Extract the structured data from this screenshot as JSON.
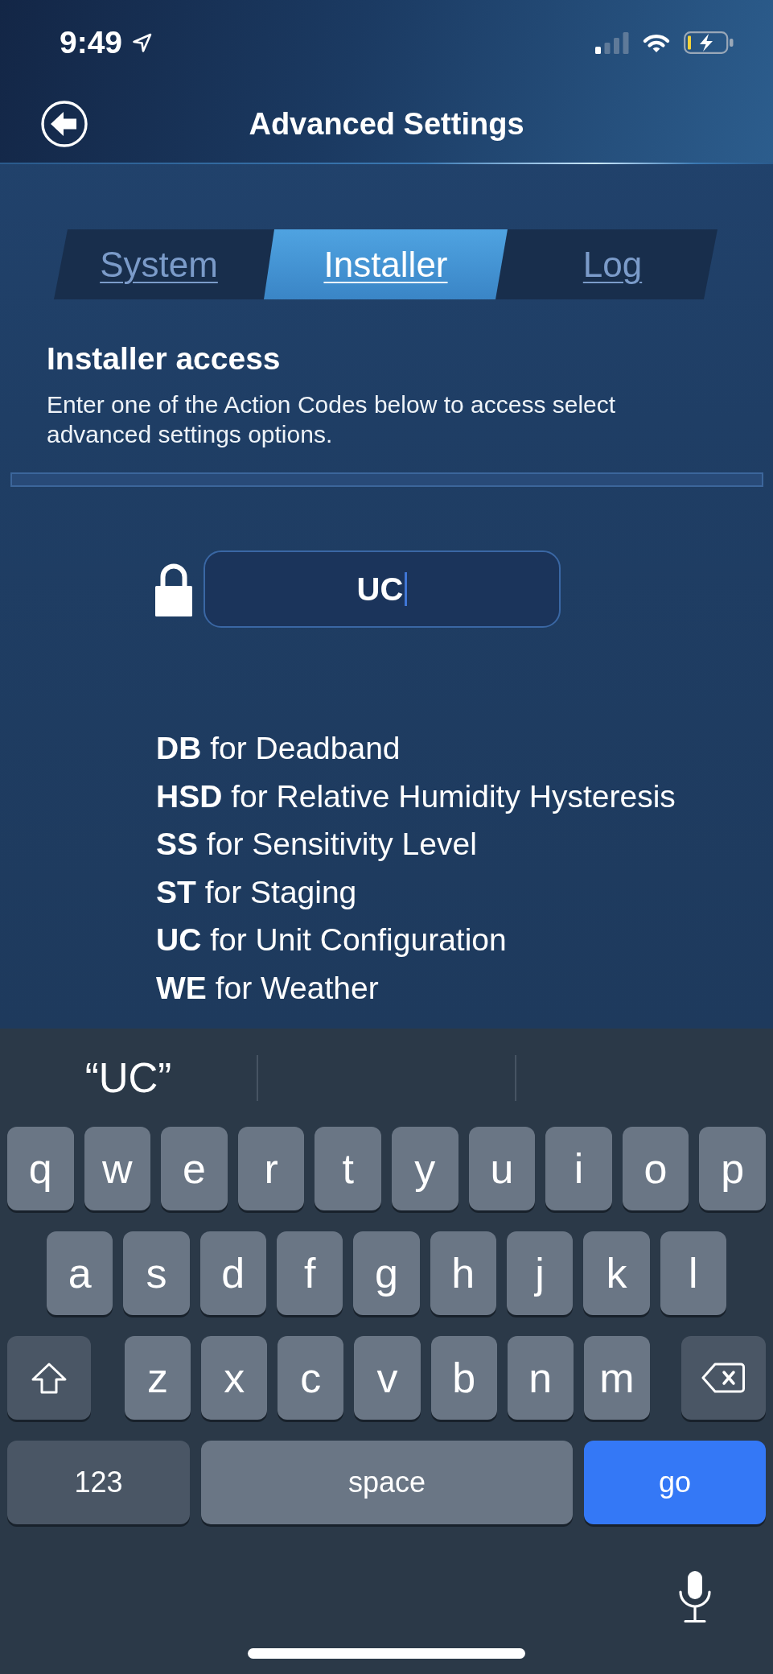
{
  "status_bar": {
    "time": "9:49"
  },
  "header": {
    "title": "Advanced Settings"
  },
  "tabs": [
    {
      "label": "System",
      "selected": false
    },
    {
      "label": "Installer",
      "selected": true
    },
    {
      "label": "Log",
      "selected": false
    }
  ],
  "installer_access": {
    "title": "Installer access",
    "description": "Enter one of the Action Codes below to access select advanced settings options.",
    "code_field": {
      "value": "UC",
      "focused": true
    },
    "action_codes": [
      "**DB** for Deadband",
      "**HSD** for Relative Humidity Hysteresis",
      "**SS** for Sensitivity Level",
      "**ST** for Staging",
      "**UC** for Unit Configuration",
      "**WE** for Weather"
    ]
  },
  "keyboard": {
    "suggestions": [
      "“UC”"
    ],
    "rows": [
      [
        {
          "kind": "letter",
          "label": "q"
        },
        {
          "kind": "letter",
          "label": "w"
        },
        {
          "kind": "letter",
          "label": "e"
        },
        {
          "kind": "letter",
          "label": "r"
        },
        {
          "kind": "letter",
          "label": "t"
        },
        {
          "kind": "letter",
          "label": "y"
        },
        {
          "kind": "letter",
          "label": "u"
        },
        {
          "kind": "letter",
          "label": "i"
        },
        {
          "kind": "letter",
          "label": "o"
        },
        {
          "kind": "letter",
          "label": "p"
        }
      ],
      [
        {
          "kind": "letter",
          "label": "a"
        },
        {
          "kind": "letter",
          "label": "s"
        },
        {
          "kind": "letter",
          "label": "d"
        },
        {
          "kind": "letter",
          "label": "f"
        },
        {
          "kind": "letter",
          "label": "g"
        },
        {
          "kind": "letter",
          "label": "h"
        },
        {
          "kind": "letter",
          "label": "j"
        },
        {
          "kind": "letter",
          "label": "k"
        },
        {
          "kind": "letter",
          "label": "l"
        }
      ],
      [
        {
          "kind": "shift"
        },
        {
          "kind": "letter",
          "label": "z"
        },
        {
          "kind": "letter",
          "label": "x"
        },
        {
          "kind": "letter",
          "label": "c"
        },
        {
          "kind": "letter",
          "label": "v"
        },
        {
          "kind": "letter",
          "label": "b"
        },
        {
          "kind": "letter",
          "label": "n"
        },
        {
          "kind": "letter",
          "label": "m"
        },
        {
          "kind": "delete"
        }
      ]
    ],
    "bottom_row": [
      {
        "kind": "mode",
        "label": "123"
      },
      {
        "kind": "space",
        "label": "space"
      },
      {
        "kind": "return",
        "label": "go"
      }
    ]
  }
}
